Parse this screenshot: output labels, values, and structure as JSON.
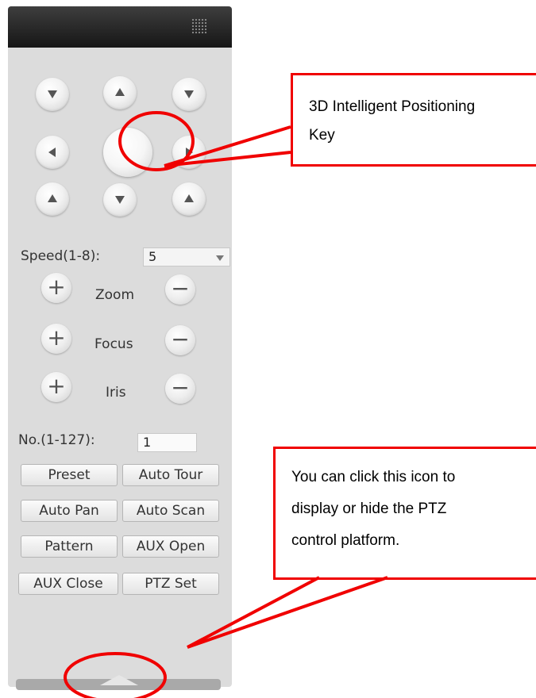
{
  "ptz": {
    "speed_label": "Speed(1-8):",
    "speed_value": "5",
    "zoom_label": "Zoom",
    "focus_label": "Focus",
    "iris_label": "Iris",
    "plus_glyph": "+",
    "minus_glyph": "−",
    "no_label": "No.(1-127):",
    "no_value": "1",
    "buttons": [
      {
        "label": "Preset"
      },
      {
        "label": "Auto Tour"
      },
      {
        "label": "Auto Pan"
      },
      {
        "label": "Auto Scan"
      },
      {
        "label": "Pattern"
      },
      {
        "label": "AUX Open"
      },
      {
        "label": "AUX Close"
      },
      {
        "label": "PTZ Set"
      }
    ]
  },
  "annotations": {
    "callout_3d_line1": "3D Intelligent Positioning",
    "callout_3d_line2": "Key",
    "callout_toggle_line1": "You can click this icon to",
    "callout_toggle_line2": "display or hide the PTZ",
    "callout_toggle_line3": "control platform.",
    "accent_color": "#f00000"
  },
  "icons": {
    "grip": "grip-dots-icon",
    "direction_arrows": "arrow-icon",
    "collapse": "collapse-triangle-icon"
  }
}
